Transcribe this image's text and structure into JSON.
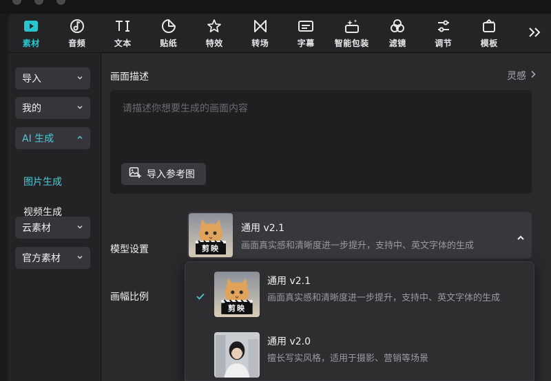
{
  "toolbar": {
    "items": [
      {
        "label": "素材",
        "icon": "media-play-icon",
        "active": true
      },
      {
        "label": "音频",
        "icon": "music-note-icon"
      },
      {
        "label": "文本",
        "icon": "text-icon"
      },
      {
        "label": "贴纸",
        "icon": "sticker-icon"
      },
      {
        "label": "特效",
        "icon": "effects-star-icon"
      },
      {
        "label": "转场",
        "icon": "transition-icon"
      },
      {
        "label": "字幕",
        "icon": "subtitle-icon"
      },
      {
        "label": "智能包装",
        "icon": "smart-package-icon"
      },
      {
        "label": "滤镜",
        "icon": "filter-icon"
      },
      {
        "label": "调节",
        "icon": "adjust-sliders-icon"
      },
      {
        "label": "模板",
        "icon": "template-icon"
      }
    ],
    "more_icon": "double-chevron-right-icon"
  },
  "sidebar": {
    "items": [
      {
        "label": "导入",
        "type": "button",
        "expanded": false
      },
      {
        "label": "我的",
        "type": "button",
        "expanded": false
      },
      {
        "label": "AI 生成",
        "type": "button",
        "expanded": true,
        "active": true
      },
      {
        "label": "图片生成",
        "type": "text",
        "active": true
      },
      {
        "label": "视频生成",
        "type": "text"
      },
      {
        "label": "云素材",
        "type": "button",
        "expanded": false
      },
      {
        "label": "官方素材",
        "type": "button",
        "expanded": false
      }
    ]
  },
  "main": {
    "description_title": "画面描述",
    "inspiration_link": "灵感",
    "prompt_placeholder": "请描述你想要生成的画面内容",
    "import_reference_label": "导入参考图",
    "model_settings_label": "模型设置",
    "aspect_ratio_label": "画幅比例",
    "selected_model": {
      "name": "通用 v2.1",
      "description": "画面真实感和清晰度进一步提升，支持中、英文字体的生成",
      "thumb_text": "剪映"
    }
  },
  "dropdown": {
    "options": [
      {
        "name": "通用 v2.1",
        "description": "画面真实感和清晰度进一步提升，支持中、英文字体的生成",
        "selected": true,
        "thumb_text": "剪映"
      },
      {
        "name": "通用 v2.0",
        "description": "擅长写实风格，适用于摄影、营销等场景",
        "selected": false
      }
    ]
  },
  "colors": {
    "accent": "#29c4d0",
    "background": "#232326",
    "panel": "#2a2a2d"
  }
}
